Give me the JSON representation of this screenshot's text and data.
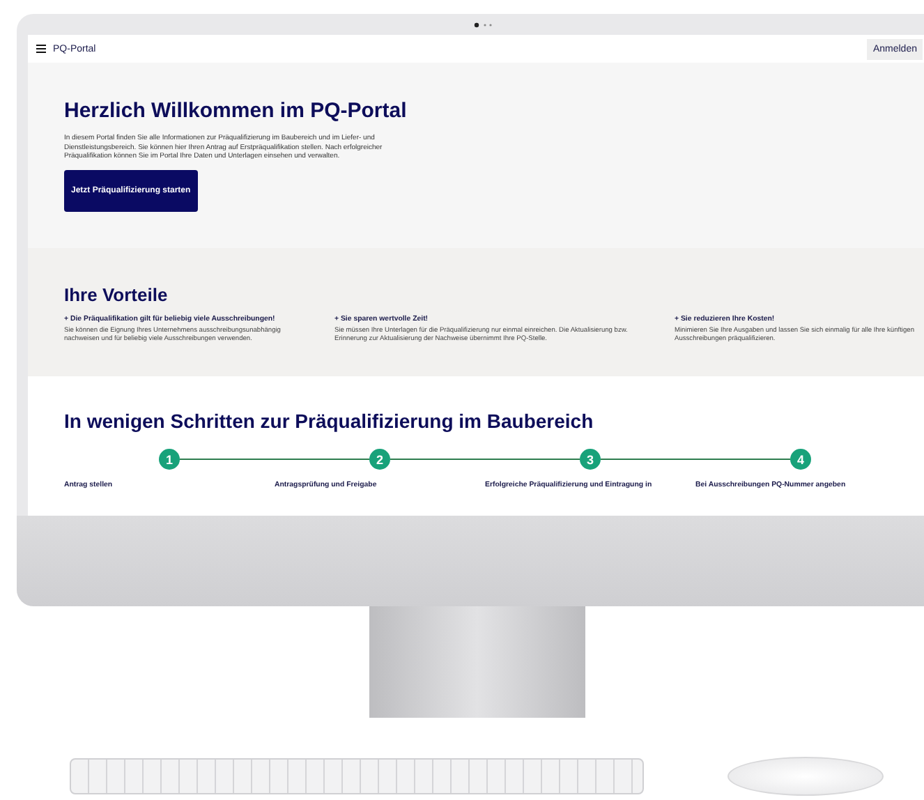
{
  "nav": {
    "brand": "PQ-Portal",
    "login_button": "Anmelden"
  },
  "hero": {
    "title": "Herzlich Willkommen im PQ-Portal",
    "text": "In diesem Portal finden Sie alle Informationen zur Präqualifizierung im Baubereich und im Liefer- und Dienstleistungsbereich. Sie können hier Ihren Antrag auf Erstpräqualifikation stellen. Nach erfolgreicher Präqualifikation können Sie im Portal Ihre Daten und Unterlagen einsehen und verwalten.",
    "button": "Jetzt Präqualifizierung starten"
  },
  "benefits": {
    "title": "Ihre Vorteile",
    "items": [
      {
        "heading": "+ Die Präqualifikation gilt für beliebig viele Ausschreibungen!",
        "text": "Sie können die Eignung Ihres Unternehmens ausschreibungsunabhängig nachweisen und für beliebig viele Ausschreibungen verwenden."
      },
      {
        "heading": "+ Sie sparen wertvolle Zeit!",
        "text": "Sie müssen Ihre Unterlagen für die Präqualifizierung nur einmal einreichen. Die Aktualisierung bzw. Erinnerung zur Aktualisierung der Nachweise übernimmt Ihre PQ-Stelle."
      },
      {
        "heading": "+ Sie reduzieren Ihre Kosten!",
        "text": "Minimieren Sie Ihre Ausgaben und lassen Sie sich einmalig für alle Ihre künftigen Ausschreibungen präqualifizieren."
      }
    ]
  },
  "steps": {
    "title": "In wenigen Schritten zur Präqualifizierung im Baubereich",
    "items": [
      {
        "number": "1",
        "label": "Antrag stellen"
      },
      {
        "number": "2",
        "label": "Antragsprüfung und Freigabe"
      },
      {
        "number": "3",
        "label": "Erfolgreiche Präqualifizierung und Eintragung in"
      },
      {
        "number": "4",
        "label": "Bei Ausschreibungen PQ-Nummer angeben"
      }
    ]
  }
}
